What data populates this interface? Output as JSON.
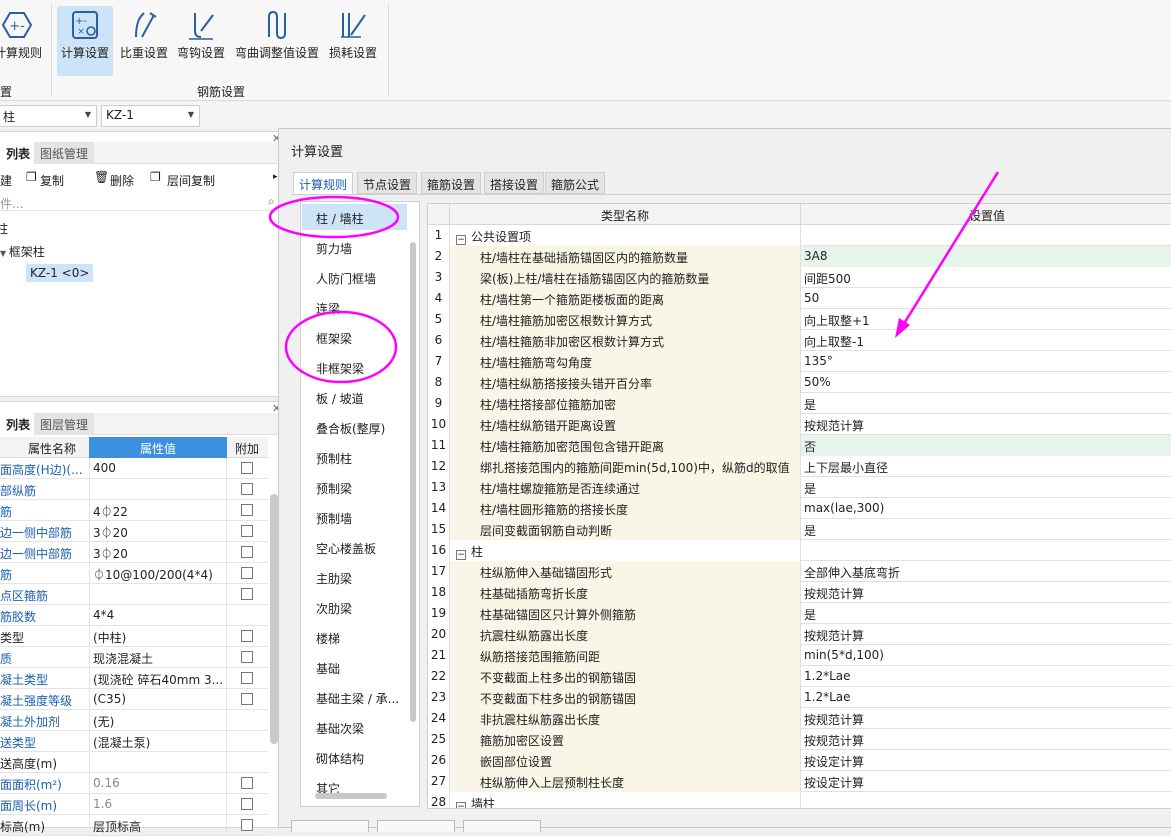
{
  "ribbon": {
    "btn_rules": "计算规则",
    "btn_calc": "计算设置",
    "btn_ratio": "比重设置",
    "btn_hook": "弯钩设置",
    "btn_bend": "弯曲调整值设置",
    "btn_loss": "损耗设置",
    "group_left": "设置",
    "group_rebar": "钢筋设置"
  },
  "selectors": {
    "type": "柱",
    "element": "KZ-1"
  },
  "tree_pane": {
    "tab_list": "列表",
    "tab_drawings": "图纸管理",
    "new": "建",
    "copy": "复制",
    "delete": "删除",
    "floor_copy": "层间复制",
    "search": "件...",
    "root": "柱",
    "node": "框架柱",
    "leaf": "KZ-1 <0>"
  },
  "prop_pane": {
    "tab_list": "列表",
    "tab_layers": "图层管理",
    "col_name": "属性名称",
    "col_value": "属性值",
    "col_add": "附加",
    "rows": [
      {
        "n": "面高度(H边)(...",
        "v": "400",
        "c": true,
        "blue": true
      },
      {
        "n": "部纵筋",
        "v": "",
        "c": true,
        "blue": true
      },
      {
        "n": "筋",
        "v": "4⏀22",
        "c": true,
        "blue": true
      },
      {
        "n": "边一侧中部筋",
        "v": "3⏀20",
        "c": true,
        "blue": true
      },
      {
        "n": "边一侧中部筋",
        "v": "3⏀20",
        "c": true,
        "blue": true
      },
      {
        "n": "筋",
        "v": "⏀10@100/200(4*4)",
        "c": true,
        "blue": true
      },
      {
        "n": "点区箍筋",
        "v": "",
        "c": true,
        "blue": true
      },
      {
        "n": "筋胶数",
        "v": "4*4",
        "c": false,
        "blue": true
      },
      {
        "n": "类型",
        "v": "(中柱)",
        "c": true,
        "blue": false
      },
      {
        "n": "质",
        "v": "现浇混凝土",
        "c": true,
        "blue": true
      },
      {
        "n": "凝土类型",
        "v": "(现浇砼 碎石40mm 3...",
        "c": true,
        "blue": true
      },
      {
        "n": "凝土强度等级",
        "v": "(C35)",
        "c": true,
        "blue": true
      },
      {
        "n": "凝土外加剂",
        "v": "(无)",
        "c": false,
        "blue": true
      },
      {
        "n": "送类型",
        "v": "(混凝土泵)",
        "c": false,
        "blue": true
      },
      {
        "n": "送高度(m)",
        "v": "",
        "c": false,
        "blue": false
      },
      {
        "n": "面面积(m²)",
        "v": "0.16",
        "c": true,
        "blue": true
      },
      {
        "n": "面周长(m)",
        "v": "1.6",
        "c": true,
        "blue": true
      },
      {
        "n": "标高(m)",
        "v": "层顶标高",
        "c": true,
        "blue": false
      }
    ]
  },
  "dialog": {
    "title": "计算设置",
    "tabs": [
      "计算规则",
      "节点设置",
      "箍筋设置",
      "搭接设置",
      "箍筋公式"
    ],
    "left_items": [
      "柱 / 墙柱",
      "剪力墙",
      "人防门框墙",
      "连梁",
      "框架梁",
      "非框架梁",
      "板 / 坡道",
      "叠合板(整厚)",
      "预制柱",
      "预制梁",
      "预制墙",
      "空心楼盖板",
      "主肋梁",
      "次肋梁",
      "楼梯",
      "基础",
      "基础主梁 / 承...",
      "基础次梁",
      "砌体结构",
      "其它"
    ],
    "col_type": "类型名称",
    "col_value": "设置值",
    "rows": [
      {
        "n": "1",
        "name": "公共设置项",
        "v": "",
        "sec": true
      },
      {
        "n": "2",
        "name": "柱/墙柱在基础插筋锚固区内的箍筋数量",
        "v": "3A8",
        "hl": true
      },
      {
        "n": "3",
        "name": "梁(板)上柱/墙柱在插筋锚固区内的箍筋数量",
        "v": "间距500"
      },
      {
        "n": "4",
        "name": "柱/墙柱第一个箍筋距楼板面的距离",
        "v": "50"
      },
      {
        "n": "5",
        "name": "柱/墙柱箍筋加密区根数计算方式",
        "v": "向上取整+1"
      },
      {
        "n": "6",
        "name": "柱/墙柱箍筋非加密区根数计算方式",
        "v": "向上取整-1"
      },
      {
        "n": "7",
        "name": "柱/墙柱箍筋弯勾角度",
        "v": "135°"
      },
      {
        "n": "8",
        "name": "柱/墙柱纵筋搭接接头错开百分率",
        "v": "50%"
      },
      {
        "n": "9",
        "name": "柱/墙柱搭接部位箍筋加密",
        "v": "是"
      },
      {
        "n": "10",
        "name": "柱/墙柱纵筋错开距离设置",
        "v": "按规范计算"
      },
      {
        "n": "11",
        "name": "柱/墙柱箍筋加密范围包含错开距离",
        "v": "否",
        "hl": true
      },
      {
        "n": "12",
        "name": "绑扎搭接范围内的箍筋间距min(5d,100)中，纵筋d的取值",
        "v": "上下层最小直径"
      },
      {
        "n": "13",
        "name": "柱/墙柱螺旋箍筋是否连续通过",
        "v": "是"
      },
      {
        "n": "14",
        "name": "柱/墙柱圆形箍筋的搭接长度",
        "v": "max(lae,300)"
      },
      {
        "n": "15",
        "name": "层间变截面钢筋自动判断",
        "v": "是"
      },
      {
        "n": "16",
        "name": "柱",
        "v": "",
        "sec": true
      },
      {
        "n": "17",
        "name": "柱纵筋伸入基础锚固形式",
        "v": "全部伸入基底弯折"
      },
      {
        "n": "18",
        "name": "柱基础插筋弯折长度",
        "v": "按规范计算"
      },
      {
        "n": "19",
        "name": "柱基础锚固区只计算外侧箍筋",
        "v": "是"
      },
      {
        "n": "20",
        "name": "抗震柱纵筋露出长度",
        "v": "按规范计算"
      },
      {
        "n": "21",
        "name": "纵筋搭接范围箍筋间距",
        "v": "min(5*d,100)"
      },
      {
        "n": "22",
        "name": "不变截面上柱多出的钢筋锚固",
        "v": "1.2*Lae"
      },
      {
        "n": "23",
        "name": "不变截面下柱多出的钢筋锚固",
        "v": "1.2*Lae"
      },
      {
        "n": "24",
        "name": "非抗震柱纵筋露出长度",
        "v": "按规范计算"
      },
      {
        "n": "25",
        "name": "箍筋加密区设置",
        "v": "按规范计算"
      },
      {
        "n": "26",
        "name": "嵌固部位设置",
        "v": "按设定计算"
      },
      {
        "n": "27",
        "name": "柱纵筋伸入上层预制柱长度",
        "v": "按设定计算"
      },
      {
        "n": "28",
        "name": "墙柱",
        "v": "",
        "sec": true
      }
    ]
  },
  "annotation_color": "#ff00ff"
}
